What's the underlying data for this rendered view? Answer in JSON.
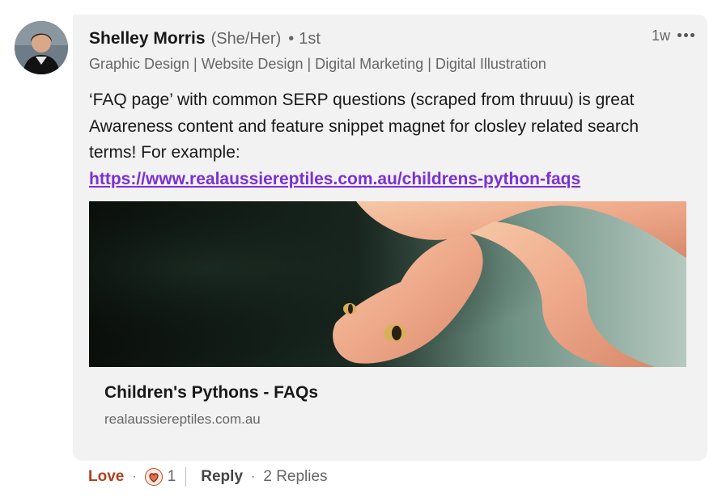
{
  "comment": {
    "author": "Shelley Morris",
    "pronouns": "(She/Her)",
    "degree_separator": "•",
    "degree": "1st",
    "headline": "Graphic Design | Website Design | Digital Marketing | Digital Illustration",
    "timestamp": "1w",
    "more_icon": "more-horizontal-icon",
    "text": "‘FAQ page’ with common SERP questions (scraped from thruuu) is great Awareness content and feature snippet magnet for closley related search terms! For example:",
    "link": "https://www.realaussiereptiles.com.au/childrens-python-faqs"
  },
  "link_preview": {
    "title": "Children's Pythons - FAQs",
    "domain": "realaussiereptiles.com.au"
  },
  "actions": {
    "love_label": "Love",
    "separator": "·",
    "reaction_icon": "heart-reaction-icon",
    "reaction_count": "1",
    "reply_label": "Reply",
    "replies_label": "2 Replies"
  },
  "colors": {
    "love": "#b24020",
    "link": "#7b2fd6",
    "bubble": "#f2f2f2"
  }
}
